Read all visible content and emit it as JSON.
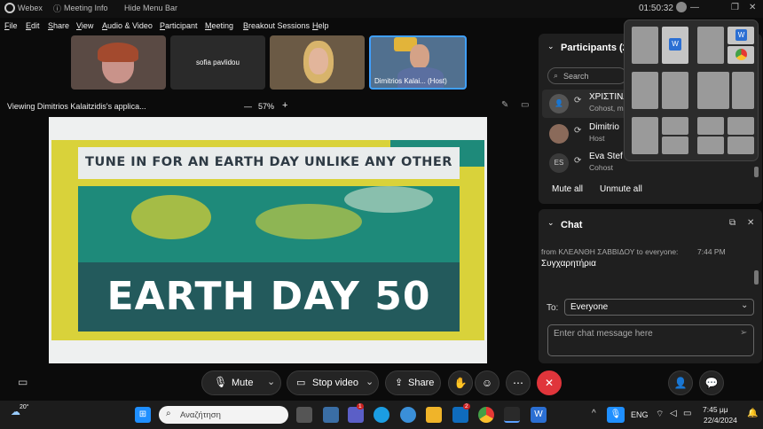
{
  "titlebar": {
    "app": "Webex",
    "meeting_info": "Meeting Info",
    "hide_menu": "Hide Menu Bar",
    "timer": "01:50:32"
  },
  "menu": [
    "File",
    "Edit",
    "Share",
    "View",
    "Audio & Video",
    "Participant",
    "Meeting",
    "Breakout Sessions",
    "Help"
  ],
  "tiles": [
    {
      "name": ""
    },
    {
      "name": "sofia pavlidou"
    },
    {
      "name": ""
    },
    {
      "name": "Dimitrios Kalai... (Host)"
    }
  ],
  "share": {
    "viewing": "Viewing Dimitrios Kalaitzidis's applica...",
    "zoom": "57%",
    "minus": "—",
    "plus": "+"
  },
  "slide": {
    "headline": "TUNE IN FOR AN EARTH DAY UNLIKE ANY OTHER",
    "big": "EARTH DAY 50"
  },
  "participants": {
    "title": "Participants (2",
    "search_placeholder": "Search",
    "list": [
      {
        "name": "ΧΡΙΣΤΙΝΑ",
        "role": "Cohost, m"
      },
      {
        "name": "Dimitrio",
        "role": "Host"
      },
      {
        "initials": "ES",
        "name": "Eva Stef",
        "role": "Cohost"
      }
    ],
    "mute_all": "Mute all",
    "unmute_all": "Unmute all"
  },
  "chat": {
    "title": "Chat",
    "from": "from ΚΛΕΑΝΘΗ ΣΑΒΒΙΔΟΥ to everyone:",
    "time": "7:44 PM",
    "message": "Συγχαρητήρια",
    "to_label": "To:",
    "to_value": "Everyone",
    "placeholder": "Enter chat message here"
  },
  "controls": {
    "mute": "Mute",
    "stop_video": "Stop video",
    "share": "Share"
  },
  "taskbar": {
    "weather": "20°",
    "search_placeholder": "Αναζήτηση",
    "lang": "ENG",
    "time": "7:45 μμ",
    "date": "22/4/2024",
    "badges": {
      "teams": "1",
      "mail": "2"
    }
  },
  "colors": {
    "accent": "#1f8fff",
    "end_call": "#e0353b",
    "earth_teal": "#1e8a7a",
    "earth_yellow": "#d9d23a",
    "bar": "#235a5c"
  }
}
